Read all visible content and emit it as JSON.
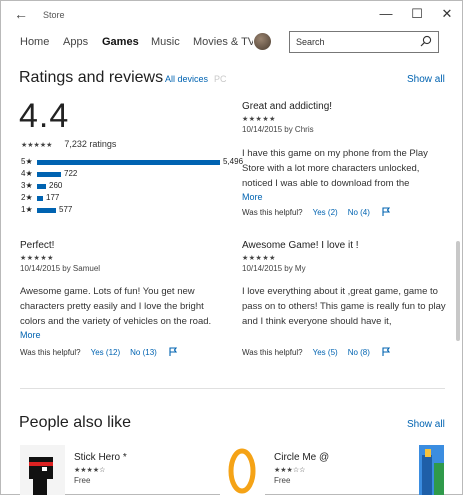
{
  "window": {
    "title": "Store",
    "back": "←",
    "minimize": "—",
    "maximize": "☐",
    "close": "✕"
  },
  "nav": {
    "tabs": [
      "Home",
      "Apps",
      "Games",
      "Music",
      "Movies & TV"
    ],
    "active": "Games"
  },
  "search": {
    "placeholder": "Search"
  },
  "ratings": {
    "heading": "Ratings and reviews",
    "filter_all": "All devices",
    "filter_pc": "PC",
    "show_all": "Show all",
    "average": "4.4",
    "average_stars": "★★★★★",
    "count_text": "7,232 ratings",
    "histogram": [
      {
        "label": "5★",
        "count": 5496,
        "text": "5,496"
      },
      {
        "label": "4★",
        "count": 722,
        "text": "722"
      },
      {
        "label": "3★",
        "count": 260,
        "text": "260"
      },
      {
        "label": "2★",
        "count": 177,
        "text": "177"
      },
      {
        "label": "1★",
        "count": 577,
        "text": "577"
      }
    ]
  },
  "reviews": [
    {
      "title": "Great and addicting!",
      "stars": "★★★★★",
      "date_author": "10/14/2015 by Chris",
      "body": "I have this game on my phone from the Play Store with a lot more characters unlocked, noticed I was able to download from the",
      "more": "More",
      "helpful": "Was this helpful?",
      "yes": "Yes (2)",
      "no": "No (4)"
    },
    {
      "title": "Perfect!",
      "stars": "★★★★★",
      "date_author": "10/14/2015 by Samuel",
      "body": "Awesome game. Lots of fun! You get new characters pretty easily and I love the bright colors and the variety of vehicles on the road.",
      "more": "More",
      "helpful": "Was this helpful?",
      "yes": "Yes (12)",
      "no": "No (13)"
    },
    {
      "title": "Awesome Game! I love it !",
      "stars": "★★★★★",
      "date_author": "10/14/2015 by My",
      "body": "I love everything about it ,great game, game to pass on to others! This game is really fun to play and I think everyone should have it,",
      "more": "",
      "helpful": "Was this helpful?",
      "yes": "Yes (5)",
      "no": "No (8)"
    }
  ],
  "people_also_like": {
    "heading": "People also like",
    "show_all": "Show all",
    "items": [
      {
        "name": "Stick Hero *",
        "stars": "★★★★☆",
        "price": "Free"
      },
      {
        "name": "Circle Me @",
        "stars": "★★★☆☆",
        "price": "Free"
      }
    ]
  },
  "colors": {
    "accent": "#0063b1"
  }
}
